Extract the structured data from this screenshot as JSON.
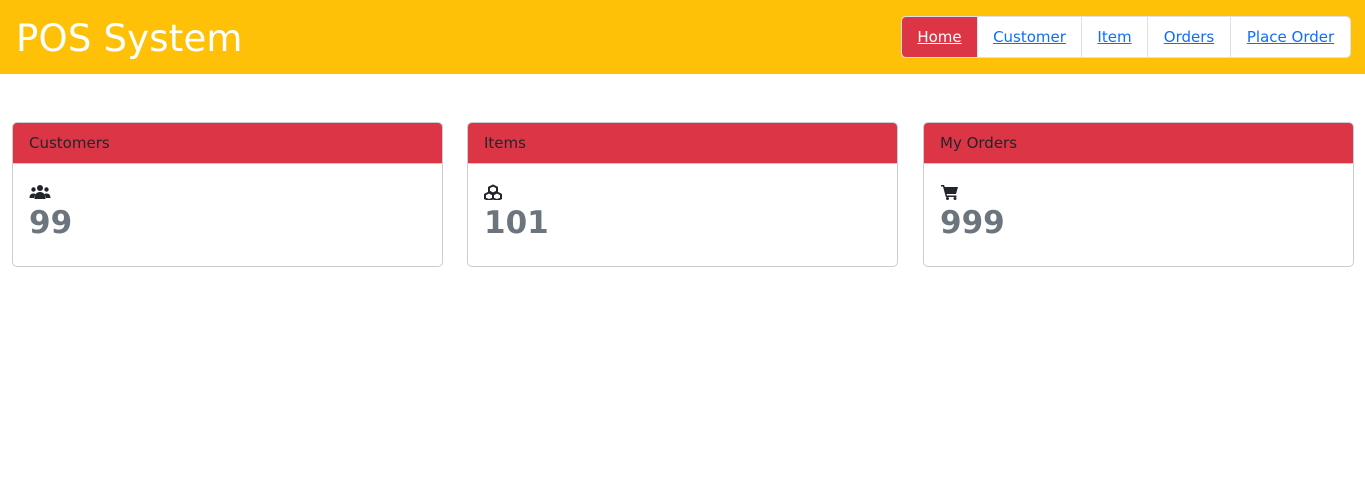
{
  "header": {
    "title": "POS System",
    "background": "#ffc107"
  },
  "nav": {
    "items": [
      {
        "label": "Home",
        "active": true
      },
      {
        "label": "Customer",
        "active": false
      },
      {
        "label": "Item",
        "active": false
      },
      {
        "label": "Orders",
        "active": false
      },
      {
        "label": "Place Order",
        "active": false
      }
    ],
    "active_color": "#dc3545",
    "link_color": "#0d6efd"
  },
  "cards": [
    {
      "title": "Customers",
      "icon": "users-icon",
      "value": "99"
    },
    {
      "title": "Items",
      "icon": "cubes-icon",
      "value": "101"
    },
    {
      "title": "My Orders",
      "icon": "shopping-cart-icon",
      "value": "999"
    }
  ],
  "card_header_color": "#dc3545"
}
